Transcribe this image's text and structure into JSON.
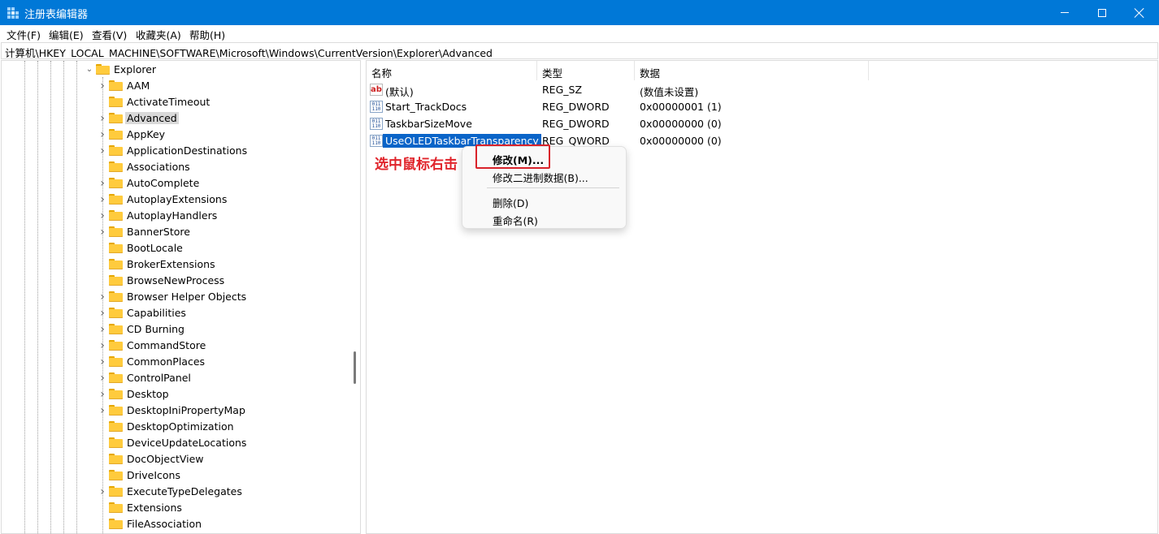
{
  "window": {
    "title": "注册表编辑器",
    "controls": {
      "minimize": "minimize-icon",
      "maximize": "maximize-icon",
      "close": "close-icon"
    }
  },
  "menu": [
    "文件(F)",
    "编辑(E)",
    "查看(V)",
    "收藏夹(A)",
    "帮助(H)"
  ],
  "address": "计算机\\HKEY_LOCAL_MACHINE\\SOFTWARE\\Microsoft\\Windows\\CurrentVersion\\Explorer\\Advanced",
  "tree": {
    "parent": {
      "label": "Explorer",
      "expanded": true
    },
    "items": [
      {
        "label": "AAM",
        "has_children": true
      },
      {
        "label": "ActivateTimeout",
        "has_children": false
      },
      {
        "label": "Advanced",
        "has_children": true,
        "selected": true
      },
      {
        "label": "AppKey",
        "has_children": true
      },
      {
        "label": "ApplicationDestinations",
        "has_children": true
      },
      {
        "label": "Associations",
        "has_children": false
      },
      {
        "label": "AutoComplete",
        "has_children": true
      },
      {
        "label": "AutoplayExtensions",
        "has_children": true
      },
      {
        "label": "AutoplayHandlers",
        "has_children": true
      },
      {
        "label": "BannerStore",
        "has_children": true
      },
      {
        "label": "BootLocale",
        "has_children": false
      },
      {
        "label": "BrokerExtensions",
        "has_children": false
      },
      {
        "label": "BrowseNewProcess",
        "has_children": false
      },
      {
        "label": "Browser Helper Objects",
        "has_children": true
      },
      {
        "label": "Capabilities",
        "has_children": true
      },
      {
        "label": "CD Burning",
        "has_children": true
      },
      {
        "label": "CommandStore",
        "has_children": true
      },
      {
        "label": "CommonPlaces",
        "has_children": true
      },
      {
        "label": "ControlPanel",
        "has_children": true
      },
      {
        "label": "Desktop",
        "has_children": true
      },
      {
        "label": "DesktopIniPropertyMap",
        "has_children": true
      },
      {
        "label": "DesktopOptimization",
        "has_children": false
      },
      {
        "label": "DeviceUpdateLocations",
        "has_children": false
      },
      {
        "label": "DocObjectView",
        "has_children": false
      },
      {
        "label": "DriveIcons",
        "has_children": false
      },
      {
        "label": "ExecuteTypeDelegates",
        "has_children": true
      },
      {
        "label": "Extensions",
        "has_children": false
      },
      {
        "label": "FileAssociation",
        "has_children": false
      }
    ]
  },
  "list": {
    "columns": [
      "名称",
      "类型",
      "数据"
    ],
    "rows": [
      {
        "icon": "string-value-icon",
        "name": "(默认)",
        "type": "REG_SZ",
        "data": "(数值未设置)"
      },
      {
        "icon": "binary-value-icon",
        "name": "Start_TrackDocs",
        "type": "REG_DWORD",
        "data": "0x00000001 (1)"
      },
      {
        "icon": "binary-value-icon",
        "name": "TaskbarSizeMove",
        "type": "REG_DWORD",
        "data": "0x00000000 (0)"
      },
      {
        "icon": "binary-value-icon",
        "name": "UseOLEDTaskbarTransparency",
        "type": "REG_QWORD",
        "data": "0x00000000 (0)",
        "selected": true
      }
    ]
  },
  "context_menu": {
    "items": [
      "修改(M)...",
      "修改二进制数据(B)...",
      "删除(D)",
      "重命名(R)"
    ]
  },
  "annotation": {
    "text": "选中鼠标右击",
    "color": "#e0242b"
  },
  "colors": {
    "titlebar": "#0078d7",
    "selection": "#0a64c8",
    "tree_selected": "#d9d9d9",
    "folder": "#ffcb3d"
  }
}
